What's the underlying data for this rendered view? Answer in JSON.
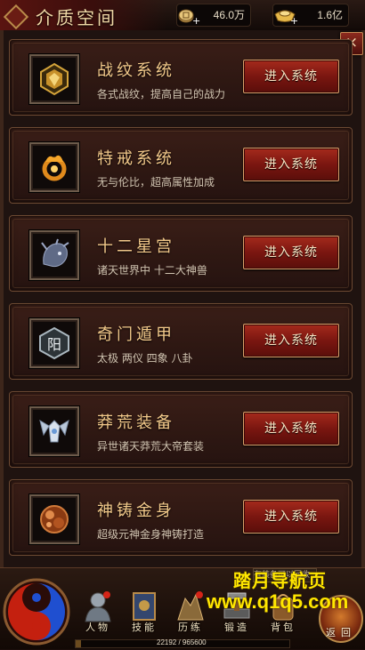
{
  "header": {
    "title": "介质空间",
    "resources": [
      {
        "icon": "coins-add-icon",
        "value": "46.0万"
      },
      {
        "icon": "gold-ingot-add-icon",
        "value": "1.6亿"
      }
    ]
  },
  "close_label": "×",
  "systems": [
    {
      "icon": "battle-pattern-emblem-icon",
      "title": "战纹系统",
      "desc": "各式战纹，提高自己的战力",
      "button": "进入系统"
    },
    {
      "icon": "fire-ring-icon",
      "title": "特戒系统",
      "desc": "无与伦比，超高属性加成",
      "button": "进入系统"
    },
    {
      "icon": "dragon-head-icon",
      "title": "十二星宫",
      "desc": "诸天世界中 十二大神兽",
      "button": "进入系统"
    },
    {
      "icon": "yang-rune-icon",
      "title": "奇门遁甲",
      "desc": "太极 两仪 四象 八卦",
      "button": "进入系统"
    },
    {
      "icon": "winged-armor-icon",
      "title": "莽荒装备",
      "desc": "异世诸天莽荒大帝套装",
      "button": "进入系统"
    },
    {
      "icon": "golden-body-orb-icon",
      "title": "神铸金身",
      "desc": "超级元神金身神铸打造",
      "button": "进入系统"
    }
  ],
  "bottom_nav": [
    {
      "icon": "character-icon",
      "label": "人物"
    },
    {
      "icon": "skill-book-icon",
      "label": "技能"
    },
    {
      "icon": "training-icon",
      "label": "历练"
    },
    {
      "icon": "forge-icon",
      "label": "锻造"
    },
    {
      "icon": "backpack-icon",
      "label": "背包"
    }
  ],
  "back_label": "返回",
  "tip_text": "有装备可以回收",
  "exp": {
    "text": "22192 / 965600",
    "current": 22192,
    "max": 965600
  },
  "watermark": {
    "line1": "踏月导航页",
    "line2": "www.q1q5.com"
  },
  "colors": {
    "accent_gold": "#f2c98a",
    "button_red": "#a52a1c",
    "watermark_yellow": "#ffe600"
  }
}
